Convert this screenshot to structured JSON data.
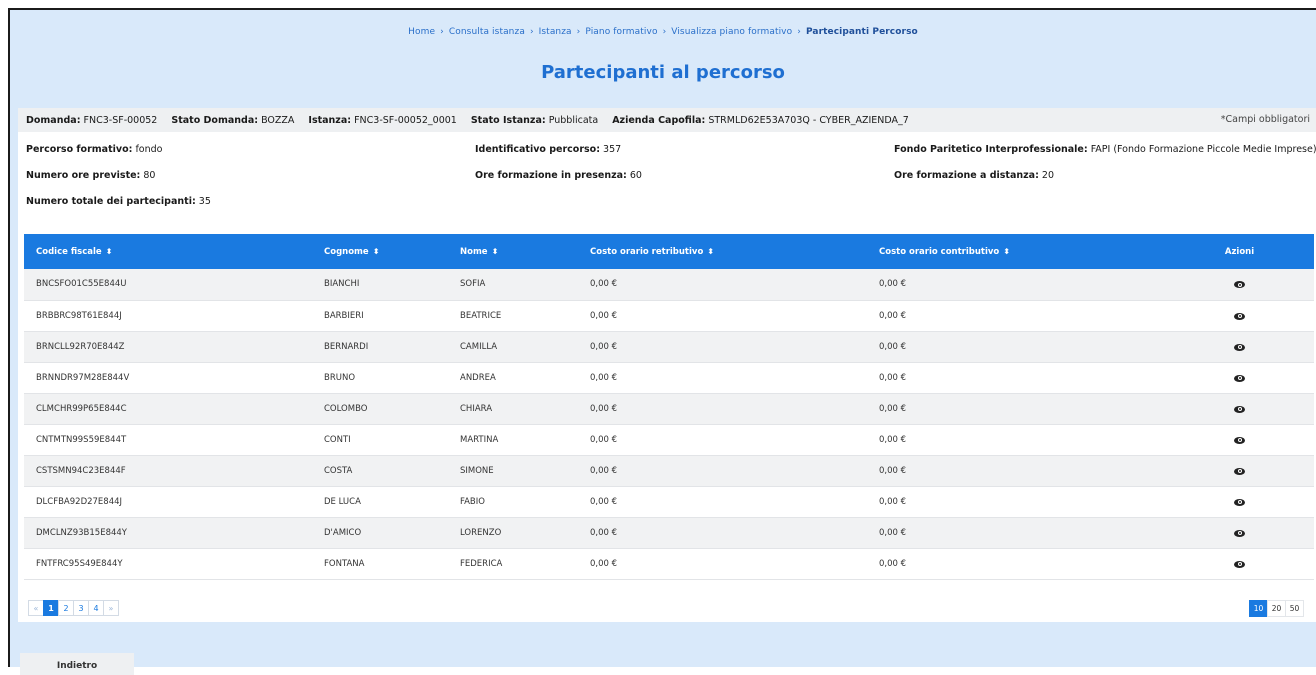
{
  "breadcrumb": {
    "items": [
      "Home",
      "Consulta istanza",
      "Istanza",
      "Piano formativo",
      "Visualizza piano formativo"
    ],
    "current": "Partecipanti Percorso"
  },
  "page_title": "Partecipanti al percorso",
  "summary": {
    "domanda_label": "Domanda:",
    "domanda_value": "FNC3-SF-00052",
    "stato_domanda_label": "Stato Domanda:",
    "stato_domanda_value": "BOZZA",
    "istanza_label": "Istanza:",
    "istanza_value": "FNC3-SF-00052_0001",
    "stato_istanza_label": "Stato Istanza:",
    "stato_istanza_value": "Pubblicata",
    "azienda_label": "Azienda Capofila:",
    "azienda_value": "STRMLD62E53A703Q - CYBER_AZIENDA_7",
    "required_note": "*Campi obbligatori"
  },
  "details": {
    "percorso_label": "Percorso formativo:",
    "percorso_value": "fondo",
    "identificativo_label": "Identificativo percorso:",
    "identificativo_value": "357",
    "fondo_label": "Fondo Paritetico Interprofessionale:",
    "fondo_value": "FAPI (Fondo Formazione Piccole Medie Imprese)",
    "ore_previste_label": "Numero ore previste:",
    "ore_previste_value": "80",
    "ore_presenza_label": "Ore formazione in presenza:",
    "ore_presenza_value": "60",
    "ore_distanza_label": "Ore formazione a distanza:",
    "ore_distanza_value": "20",
    "partecipanti_label": "Numero totale dei partecipanti:",
    "partecipanti_value": "35"
  },
  "table": {
    "columns": [
      "Codice fiscale",
      "Cognome",
      "Nome",
      "Costo orario retributivo",
      "Costo orario contributivo",
      "Azioni"
    ],
    "rows": [
      [
        "BNCSFO01C55E844U",
        "BIANCHI",
        "SOFIA",
        "0,00 €",
        "0,00 €"
      ],
      [
        "BRBBRC98T61E844J",
        "BARBIERI",
        "BEATRICE",
        "0,00 €",
        "0,00 €"
      ],
      [
        "BRNCLL92R70E844Z",
        "BERNARDI",
        "CAMILLA",
        "0,00 €",
        "0,00 €"
      ],
      [
        "BRNNDR97M28E844V",
        "BRUNO",
        "ANDREA",
        "0,00 €",
        "0,00 €"
      ],
      [
        "CLMCHR99P65E844C",
        "COLOMBO",
        "CHIARA",
        "0,00 €",
        "0,00 €"
      ],
      [
        "CNTMTN99S59E844T",
        "CONTI",
        "MARTINA",
        "0,00 €",
        "0,00 €"
      ],
      [
        "CSTSMN94C23E844F",
        "COSTA",
        "SIMONE",
        "0,00 €",
        "0,00 €"
      ],
      [
        "DLCFBA92D27E844J",
        "DE LUCA",
        "FABIO",
        "0,00 €",
        "0,00 €"
      ],
      [
        "DMCLNZ93B15E844Y",
        "D'AMICO",
        "LORENZO",
        "0,00 €",
        "0,00 €"
      ],
      [
        "FNTFRC95S49E844Y",
        "FONTANA",
        "FEDERICA",
        "0,00 €",
        "0,00 €"
      ]
    ]
  },
  "pagination": {
    "prev": "«",
    "pages": [
      "1",
      "2",
      "3",
      "4"
    ],
    "next": "»",
    "current": "1"
  },
  "page_sizes": {
    "options": [
      "10",
      "20",
      "50"
    ],
    "selected": "10"
  },
  "back_button": "Indietro",
  "colors": {
    "accent": "#1a7ae0",
    "background": "#d9e9fa",
    "title": "#1f6fd1"
  },
  "icons": {
    "row_action": "eye-icon",
    "sort": "sort-icon"
  }
}
